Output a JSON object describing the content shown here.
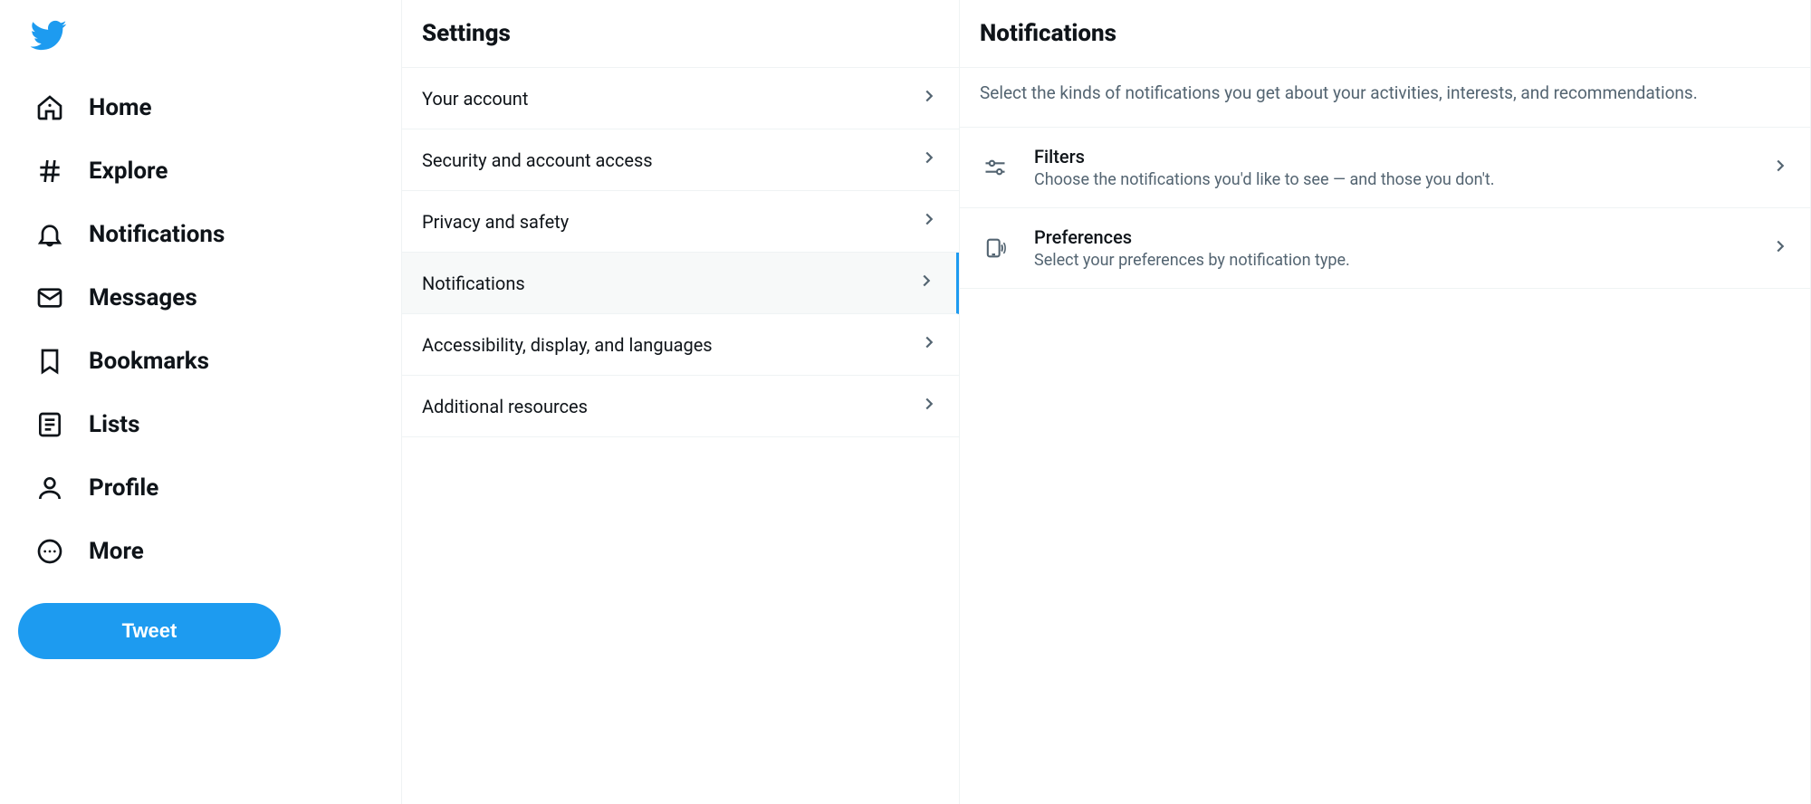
{
  "nav": {
    "items": [
      {
        "label": "Home"
      },
      {
        "label": "Explore"
      },
      {
        "label": "Notifications"
      },
      {
        "label": "Messages"
      },
      {
        "label": "Bookmarks"
      },
      {
        "label": "Lists"
      },
      {
        "label": "Profile"
      },
      {
        "label": "More"
      }
    ],
    "tweet_label": "Tweet"
  },
  "settings": {
    "title": "Settings",
    "items": [
      {
        "label": "Your account"
      },
      {
        "label": "Security and account access"
      },
      {
        "label": "Privacy and safety"
      },
      {
        "label": "Notifications"
      },
      {
        "label": "Accessibility, display, and languages"
      },
      {
        "label": "Additional resources"
      }
    ],
    "active_index": 3
  },
  "detail": {
    "title": "Notifications",
    "description": "Select the kinds of notifications you get about your activities, interests, and recommendations.",
    "items": [
      {
        "title": "Filters",
        "subtitle": "Choose the notifications you'd like to see — and those you don't."
      },
      {
        "title": "Preferences",
        "subtitle": "Select your preferences by notification type."
      }
    ]
  }
}
